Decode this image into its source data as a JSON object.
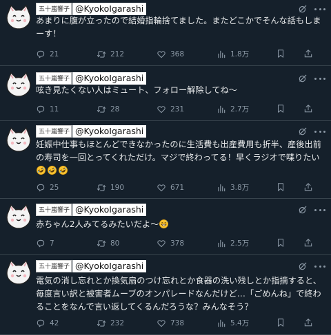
{
  "posts": [
    {
      "name": "五十嵐響子",
      "handle": "@KyokoIgarashi",
      "text": "あまりに腹が立ったので結婚指輪捨てました。またどこかでそんな話もしまーす！",
      "replies": "21",
      "reposts": "212",
      "likes": "368",
      "views": "1.8万"
    },
    {
      "name": "五十嵐響子",
      "handle": "@KyokoIgarashi",
      "text": "呟き見たくない人はミュート、フォロー解除してね〜",
      "replies": "11",
      "reposts": "28",
      "likes": "231",
      "views": "2.7万"
    },
    {
      "name": "五十嵐響子",
      "handle": "@KyokoIgarashi",
      "text": "妊娠中仕事もほとんどできなかったのに生活費も出産費用も折半、産後出前の寿司を一回とってくれただけ。マジで終わってる！早くラジオで喋りたい",
      "emoji": "rofl rofl rofl",
      "replies": "25",
      "reposts": "190",
      "likes": "671",
      "views": "3.8万"
    },
    {
      "name": "五十嵐響子",
      "handle": "@KyokoIgarashi",
      "text": "赤ちゃん2人みてるみたいだよ〜",
      "emoji": "grinning-sweat",
      "replies": "7",
      "reposts": "80",
      "likes": "378",
      "views": "2.5万"
    },
    {
      "name": "五十嵐響子",
      "handle": "@KyokoIgarashi",
      "text": "電気の消し忘れとか換気扇のつけ忘れとか食器の洗い残しとか指摘すると、毎度言い訳と被害者ムーブのオンパレードなんだけど…「ごめんね」で終わることをなんで言い返してくるんだろうな？みんなそう？",
      "replies": "42",
      "reposts": "232",
      "likes": "738",
      "views": "5.4万"
    }
  ],
  "icons": {
    "avatar": "cat-avatar",
    "grok": "grok-icon",
    "more": "more-icon",
    "reply": "reply-icon",
    "repost": "repost-icon",
    "like": "like-icon",
    "views": "views-icon",
    "bookmark": "bookmark-icon",
    "share": "share-icon"
  },
  "colors": {
    "background": "#15202b",
    "text": "#e7e9ea",
    "muted": "#8b98a5",
    "divider": "#38444d"
  }
}
